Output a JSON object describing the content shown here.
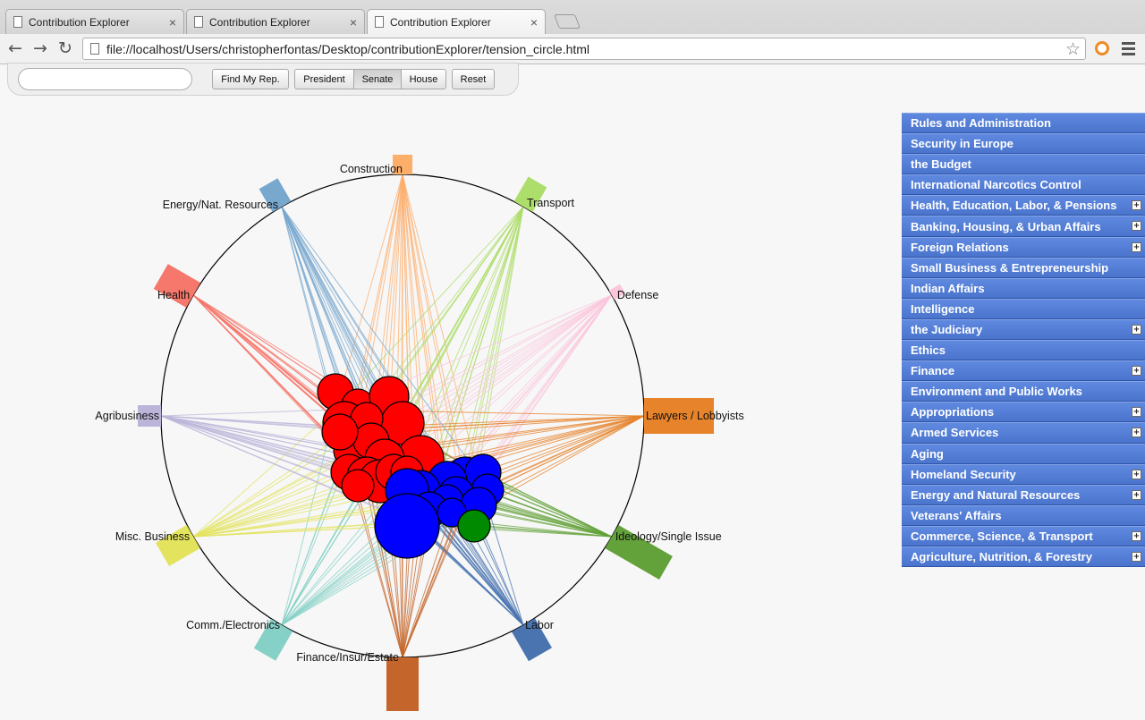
{
  "browser": {
    "tabs": [
      {
        "title": "Contribution Explorer",
        "active": false
      },
      {
        "title": "Contribution Explorer",
        "active": false
      },
      {
        "title": "Contribution Explorer",
        "active": true
      }
    ],
    "url": "file://localhost/Users/christopherfontas/Desktop/contributionExplorer/tension_circle.html",
    "icons": {
      "back": "back-arrow-icon",
      "forward": "forward-arrow-icon",
      "reload": "reload-icon",
      "bookmark": "star-icon",
      "menu": "menu-icon"
    }
  },
  "controls": {
    "search_placeholder": "",
    "find_label": "Find My Rep.",
    "chamber_buttons": [
      {
        "label": "President",
        "selected": false
      },
      {
        "label": "Senate",
        "selected": true
      },
      {
        "label": "House",
        "selected": false
      }
    ],
    "reset_label": "Reset"
  },
  "visualization": {
    "sectors": [
      {
        "label": "Construction",
        "color": "#fdae6b"
      },
      {
        "label": "Transport",
        "color": "#addd6b"
      },
      {
        "label": "Defense",
        "color": "#fbc6dc"
      },
      {
        "label": "Lawyers / Lobbyists",
        "color": "#e6832b"
      },
      {
        "label": "Ideology/Single Issue",
        "color": "#63a13a"
      },
      {
        "label": "Labor",
        "color": "#4a74b0"
      },
      {
        "label": "Finance/Insur/Estate",
        "color": "#c4662b"
      },
      {
        "label": "Comm./Electronics",
        "color": "#86d1c7"
      },
      {
        "label": "Misc. Business",
        "color": "#e3e35e"
      },
      {
        "label": "Agribusiness",
        "color": "#bcb5d9"
      },
      {
        "label": "Health",
        "color": "#f6776b"
      },
      {
        "label": "Energy/Nat. Resources",
        "color": "#79a8cf"
      }
    ],
    "party_colors": {
      "republican": "#ff0000",
      "democrat": "#0000ff",
      "independent": "#008a00"
    }
  },
  "committees": [
    {
      "label": "Rules and Administration",
      "expandable": false
    },
    {
      "label": "Security in Europe",
      "expandable": false
    },
    {
      "label": "the Budget",
      "expandable": false
    },
    {
      "label": "International Narcotics Control",
      "expandable": false
    },
    {
      "label": "Health, Education, Labor, & Pensions",
      "expandable": true
    },
    {
      "label": "Banking, Housing, & Urban Affairs",
      "expandable": true
    },
    {
      "label": "Foreign Relations",
      "expandable": true
    },
    {
      "label": "Small Business & Entrepreneurship",
      "expandable": false
    },
    {
      "label": "Indian Affairs",
      "expandable": false
    },
    {
      "label": "Intelligence",
      "expandable": false
    },
    {
      "label": "the Judiciary",
      "expandable": true
    },
    {
      "label": "Ethics",
      "expandable": false
    },
    {
      "label": "Finance",
      "expandable": true
    },
    {
      "label": "Environment and Public Works",
      "expandable": false
    },
    {
      "label": "Appropriations",
      "expandable": true
    },
    {
      "label": "Armed Services",
      "expandable": true
    },
    {
      "label": "Aging",
      "expandable": false
    },
    {
      "label": "Homeland Security",
      "expandable": true
    },
    {
      "label": "Energy and Natural Resources",
      "expandable": true
    },
    {
      "label": "Veterans' Affairs",
      "expandable": false
    },
    {
      "label": "Commerce, Science, & Transport",
      "expandable": true
    },
    {
      "label": "Agriculture, Nutrition, & Forestry",
      "expandable": true
    }
  ]
}
